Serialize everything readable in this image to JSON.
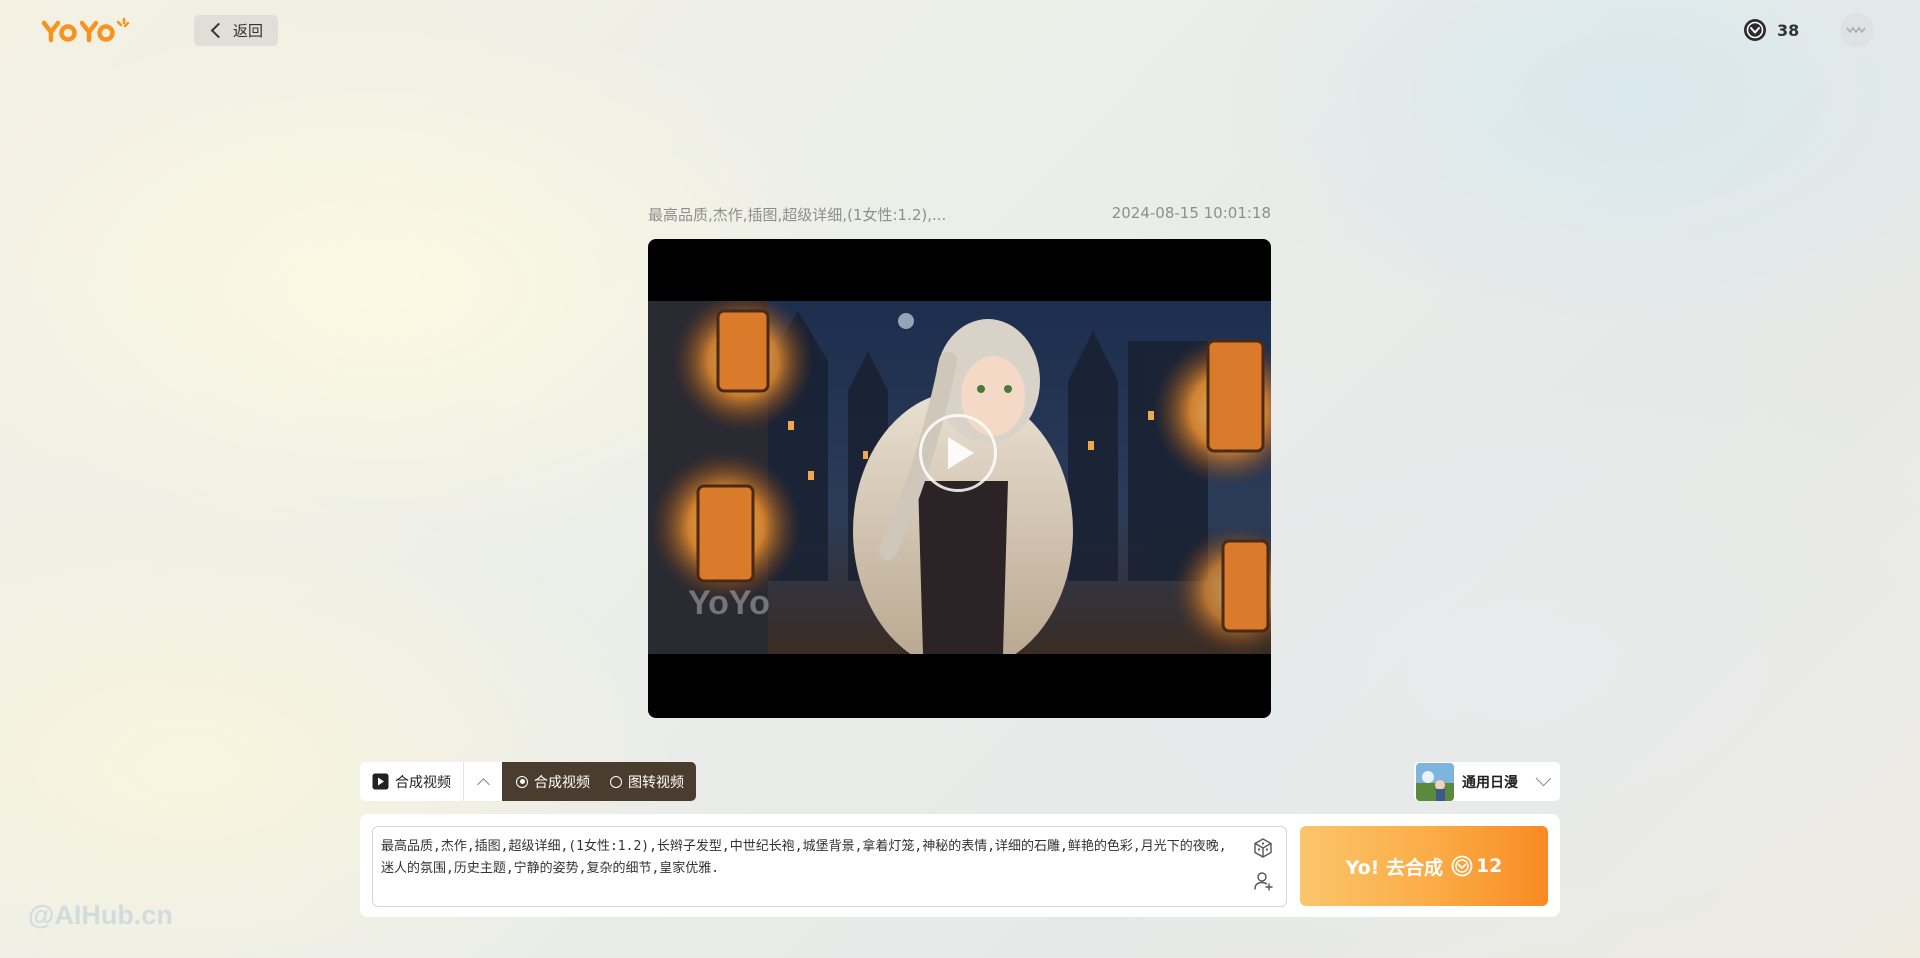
{
  "header": {
    "logo_text": "YoYo",
    "back_label": "返回",
    "credits": "38"
  },
  "video": {
    "title": "最高品质,杰作,插图,超级详细,(1女性:1.2),...",
    "timestamp": "2024-08-15 10:01:18",
    "watermark_text": "YoYo"
  },
  "mode": {
    "current_label": "合成视频",
    "options": [
      {
        "label": "合成视频",
        "checked": true
      },
      {
        "label": "图转视频",
        "checked": false
      }
    ]
  },
  "style": {
    "label": "通用日漫"
  },
  "prompt": {
    "text": "最高品质,杰作,插图,超级详细,(1女性:1.2),长辫子发型,中世纪长袍,城堡背景,拿着灯笼,神秘的表情,详细的石雕,鲜艳的色彩,月光下的夜晚,迷人的氛围,历史主题,宁静的姿势,复杂的细节,皇家优雅."
  },
  "generate": {
    "label": "Yo! 去合成",
    "cost": "12"
  },
  "page_watermark": "@AIHub.cn",
  "colors": {
    "brand_orange": "#f98a22",
    "mode_bg": "#4a3c2e"
  }
}
